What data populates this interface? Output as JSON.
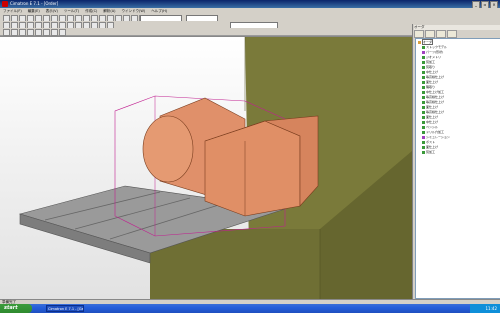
{
  "app": {
    "title": "Cimatron E 7.1 - [Order]",
    "window_buttons": [
      "_",
      "▫",
      "×"
    ]
  },
  "menu": [
    "ファイル(F)",
    "編集(E)",
    "表示(V)",
    "ツール(T)",
    "作成(C)",
    "解析(A)",
    "ウインドウ(W)",
    "ヘルプ(H)"
  ],
  "tree": {
    "header": "オーダ",
    "items": [
      {
        "label": "オーダ"
      },
      {
        "label": "ストックモデル"
      },
      {
        "label": "パーツ(形状)"
      },
      {
        "label": "ジオメトリ"
      },
      {
        "label": "荒加工"
      },
      {
        "label": "荒取り"
      },
      {
        "label": "中仕上げ"
      },
      {
        "label": "等高線仕上げ"
      },
      {
        "label": "面仕上げ"
      },
      {
        "label": "隅取り"
      },
      {
        "label": "中仕上げ加工"
      },
      {
        "label": "等高線仕上げ"
      },
      {
        "label": "等高線仕上げ"
      },
      {
        "label": "面仕上げ"
      },
      {
        "label": "等高線仕上げ"
      },
      {
        "label": "面仕上げ"
      },
      {
        "label": "中仕上げ"
      },
      {
        "label": "ペンシル"
      },
      {
        "label": "ドリル穴加工"
      },
      {
        "label": "シミュレーション"
      },
      {
        "label": "ポスト"
      },
      {
        "label": "面仕上げ"
      },
      {
        "label": "荒加工"
      }
    ]
  },
  "status": {
    "text": "準備完了"
  },
  "taskbar": {
    "start_label": "start",
    "task_label": "Cimatron E 7.1 - [Ge...",
    "clock": "11:42"
  },
  "colors": {
    "part": "#e0906a",
    "machine": "#7a7a3a",
    "table": "#8e8e8e",
    "selection": "#c02090"
  }
}
